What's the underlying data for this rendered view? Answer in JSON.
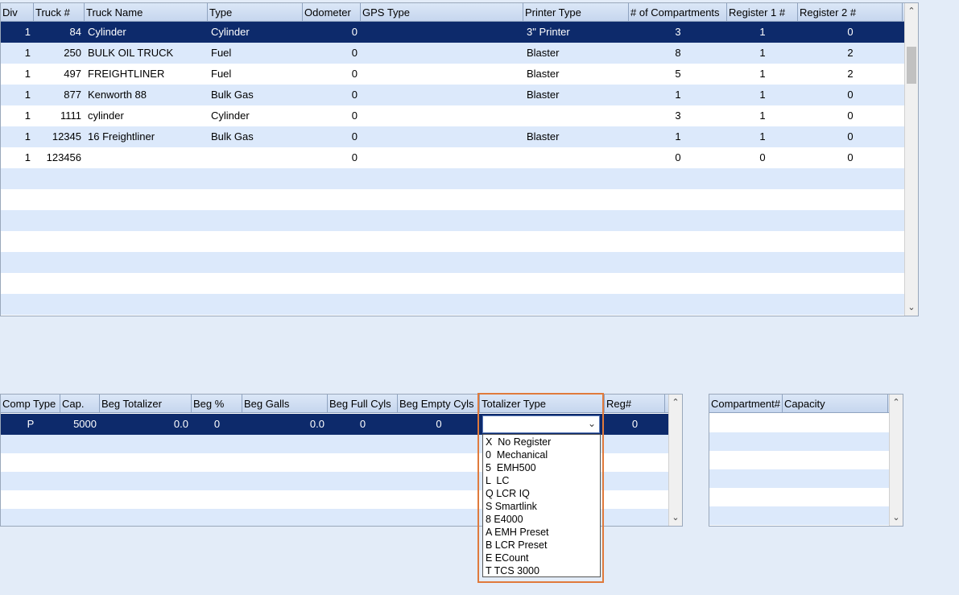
{
  "trucks": {
    "columns": [
      "Div",
      "Truck #",
      "Truck Name",
      "Type",
      "Odometer",
      "GPS Type",
      "Printer Type",
      "# of Compartments",
      "Register 1 #",
      "Register 2 #"
    ],
    "rows": [
      [
        "1",
        "84",
        "Cylinder",
        "Cylinder",
        "0",
        "",
        "3\" Printer",
        "3",
        "1",
        "0"
      ],
      [
        "1",
        "250",
        "BULK OIL TRUCK",
        "Fuel",
        "0",
        "",
        "Blaster",
        "8",
        "1",
        "2"
      ],
      [
        "1",
        "497",
        "FREIGHTLINER",
        "Fuel",
        "0",
        "",
        "Blaster",
        "5",
        "1",
        "2"
      ],
      [
        "1",
        "877",
        "Kenworth 88",
        "Bulk Gas",
        "0",
        "",
        "Blaster",
        "1",
        "1",
        "0"
      ],
      [
        "1",
        "1111",
        "cylinder",
        "Cylinder",
        "0",
        "",
        "",
        "3",
        "1",
        "0"
      ],
      [
        "1",
        "12345",
        "16 Freightliner",
        "Bulk Gas",
        "0",
        "",
        "Blaster",
        "1",
        "1",
        "0"
      ],
      [
        "1",
        "123456",
        "",
        "",
        "0",
        "",
        "",
        "0",
        "0",
        "0"
      ]
    ],
    "selected_row": 0,
    "empty_rows": 7
  },
  "compartments": {
    "columns": [
      "Comp Type",
      "Cap.",
      "Beg Totalizer",
      "Beg %",
      "Beg Galls",
      "Beg Full Cyls",
      "Beg Empty Cyls",
      "Totalizer Type",
      "Reg#"
    ],
    "rows": [
      [
        "P",
        "5000",
        "0.0",
        "0",
        "0.0",
        "0",
        "0",
        "",
        "0"
      ]
    ],
    "empty_rows": 5
  },
  "totalizer_dropdown": {
    "selected": "",
    "options": [
      "X  No Register",
      "0  Mechanical",
      "5  EMH500",
      "L  LC",
      "Q LCR IQ",
      "S Smartlink",
      "8 E4000",
      "A EMH Preset",
      "B LCR Preset",
      "E ECount",
      "T TCS 3000"
    ],
    "highlight_color": "#e07a3c"
  },
  "capacity": {
    "columns": [
      "Compartment#",
      "Capacity"
    ],
    "empty_rows": 6
  },
  "colors": {
    "selection": "#0d2a6b",
    "alt_row": "#dce9fb",
    "background": "#e3ecf8"
  }
}
